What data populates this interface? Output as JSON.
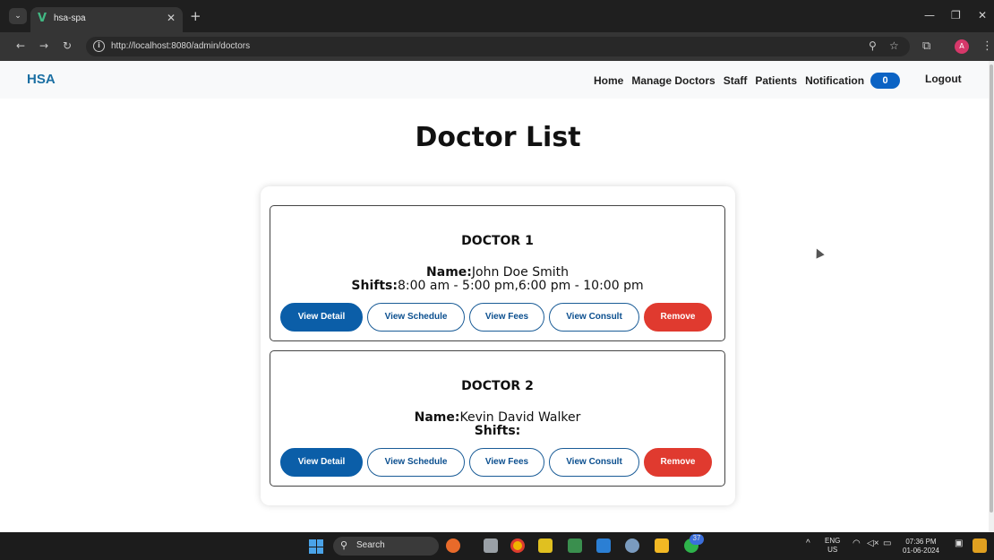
{
  "browser": {
    "tab_title": "hsa-spa",
    "url": "http://localhost:8080/admin/doctors",
    "profile_initial": "A"
  },
  "navbar": {
    "brand": "HSA",
    "links": [
      "Home",
      "Manage Doctors",
      "Staff",
      "Patients",
      "Notification"
    ],
    "notification_count": "0",
    "logout": "Logout"
  },
  "page": {
    "title": "Doctor List",
    "doctors": [
      {
        "heading": "DOCTOR 1",
        "name_label": "Name:",
        "name": "John Doe Smith",
        "shifts_label": "Shifts:",
        "shifts": "8:00 am - 5:00 pm,6:00 pm - 10:00 pm"
      },
      {
        "heading": "DOCTOR 2",
        "name_label": "Name:",
        "name": "Kevin David Walker",
        "shifts_label": "Shifts:",
        "shifts": ""
      }
    ],
    "buttons": {
      "view_detail": "View Detail",
      "view_schedule": "View Schedule",
      "view_fees": "View Fees",
      "view_consult": "View Consult",
      "remove": "Remove"
    },
    "colors": {
      "primary": "#0b5ea8",
      "danger": "#e03a2f",
      "badge": "#0b63c4",
      "brand": "#1a6fa3"
    }
  },
  "taskbar": {
    "search_placeholder": "Search",
    "language": "ENG",
    "region": "US",
    "time": "07:36 PM",
    "date": "01-06-2024",
    "chat_badge": "37"
  }
}
